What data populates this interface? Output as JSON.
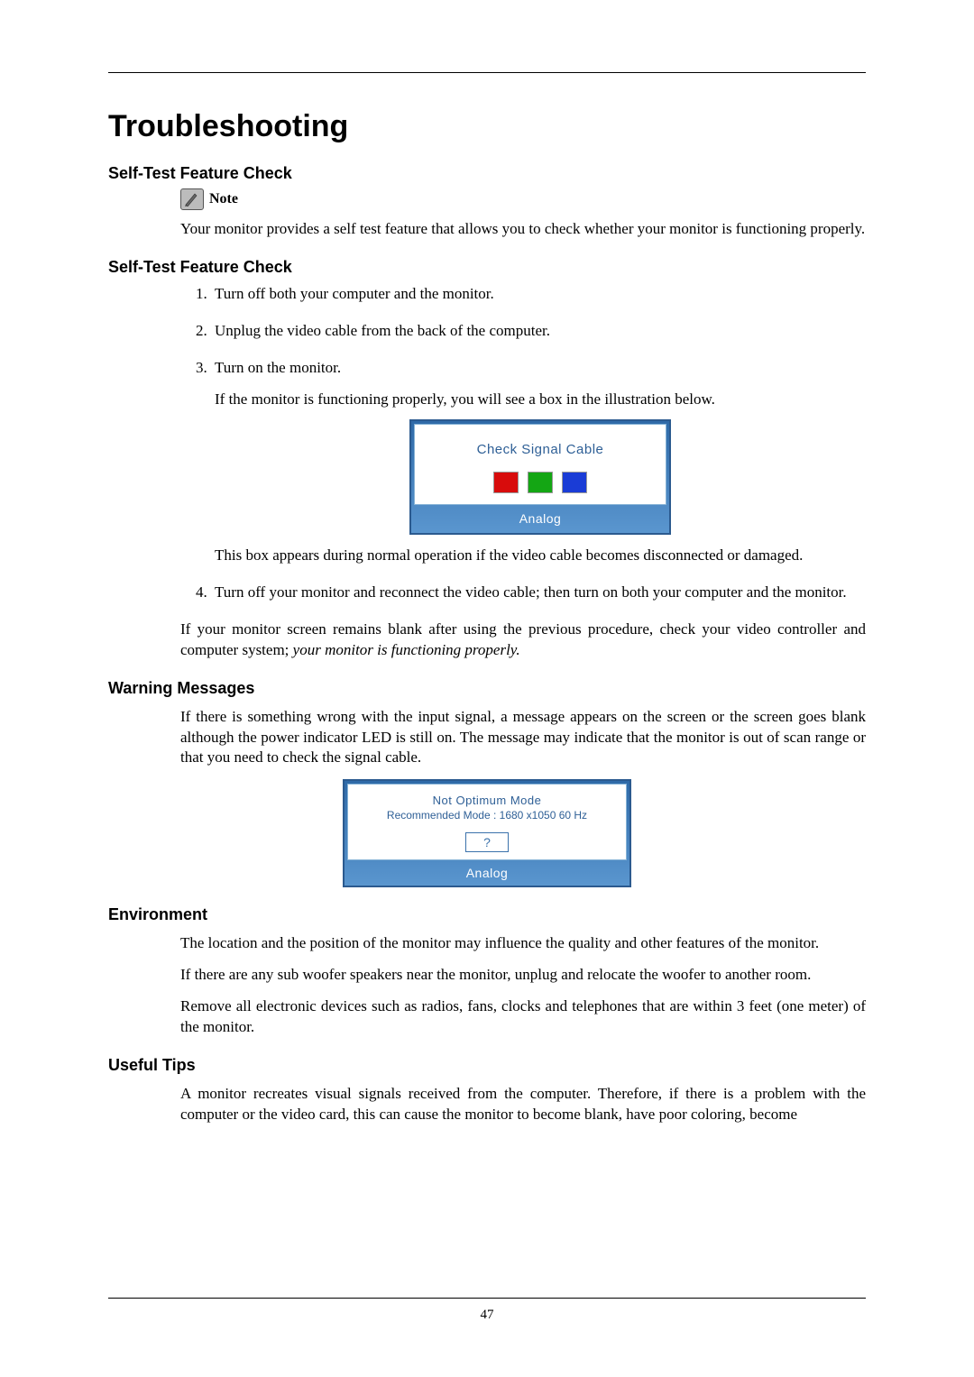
{
  "title": "Troubleshooting",
  "sections": {
    "selftest1": "Self-Test Feature Check",
    "selftest2": "Self-Test Feature Check",
    "warning": "Warning Messages",
    "environment": "Environment",
    "usefultips": "Useful Tips"
  },
  "note_label": "Note",
  "body": {
    "note_para": "Your monitor provides a self test feature that allows you to check whether your monitor is functioning properly.",
    "step1": "Turn off both your computer and the monitor.",
    "step2": "Unplug the video cable from the back of the computer.",
    "step3": "Turn on the monitor.",
    "step3_sub": "If the monitor is functioning properly, you will see a box in the illustration below.",
    "step3_sub2": "This box appears during normal operation if the video cable becomes disconnected or damaged.",
    "step4": "Turn off your monitor and reconnect the video cable; then turn on both your computer and the monitor.",
    "post_steps_1": "If your monitor screen remains blank after using the previous procedure, check your video controller and computer system; ",
    "post_steps_italic": "your monitor is functioning properly.",
    "warning_para": "If there is something wrong with the input signal, a message appears on the screen or the screen goes blank although the power indicator LED is still on. The message may indicate that the monitor is out of scan range or that you need to check the signal cable.",
    "env_p1": "The location and the position of the monitor may influence the quality and other features of the monitor.",
    "env_p2": "If there are any sub woofer speakers near the monitor, unplug and relocate the woofer to another room.",
    "env_p3": "Remove all electronic devices such as radios, fans, clocks and telephones that are within 3 feet (one meter) of the monitor.",
    "tips_p1": "A monitor recreates visual signals received from the computer. Therefore, if there is a problem with the computer or the video card, this can cause the monitor to become blank, have poor coloring, become"
  },
  "dialog1": {
    "line": "Check Signal Cable",
    "footer": "Analog"
  },
  "dialog2": {
    "line1": "Not Optimum Mode",
    "line2": "Recommended Mode : 1680 x1050 60 Hz",
    "qmark": "?",
    "footer": "Analog"
  },
  "page_number": "47"
}
